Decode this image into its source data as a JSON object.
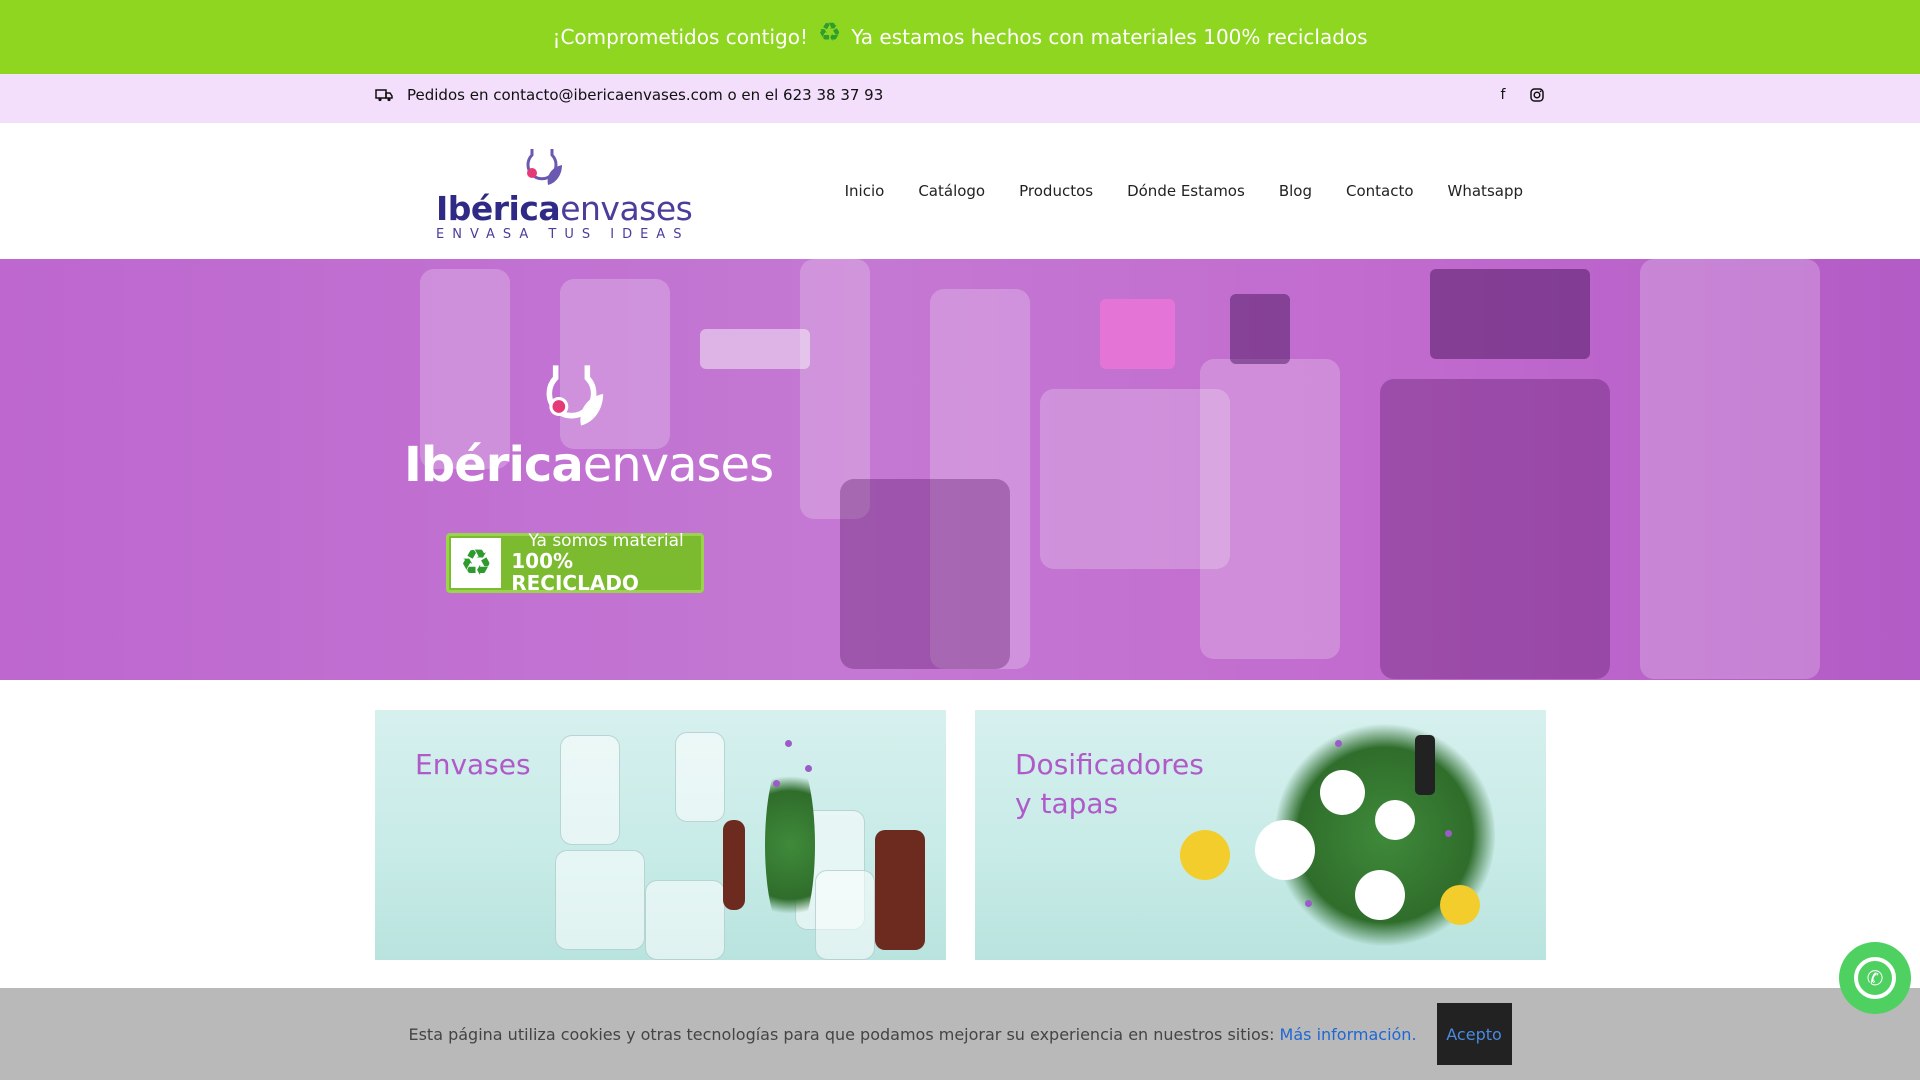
{
  "promo": {
    "text_before": "¡Comprometidos contigo!",
    "icon": "recycle-icon",
    "text_after": "Ya estamos hechos con materiales 100% reciclados",
    "bg_color": "#8fd620"
  },
  "topbar": {
    "contact_text": "Pedidos en contacto@ibericaenvases.com o en el 623 38 37 93",
    "social": [
      "facebook-icon",
      "instagram-icon"
    ],
    "bg_color": "#f3defb"
  },
  "logo": {
    "brand_bold": "Ibérica",
    "brand_light": "envases",
    "tagline": "ENVASA TUS IDEAS"
  },
  "nav": {
    "items": [
      "Inicio",
      "Catálogo",
      "Productos",
      "Dónde Estamos",
      "Blog",
      "Contacto",
      "Whatsapp"
    ]
  },
  "hero": {
    "brand_bold": "Ibérica",
    "brand_light": "envases",
    "badge_line1": "Ya somos material",
    "badge_line2": "100% RECICLADO",
    "overlay_color": "#c06bd0"
  },
  "cards": [
    {
      "title": "Envases"
    },
    {
      "title_line1": "Dosificadores",
      "title_line2": "y tapas"
    }
  ],
  "cookie": {
    "text": "Esta página utiliza cookies y otras tecnologías para que podamos mejorar su experiencia en nuestros sitios:",
    "link": "Más información.",
    "accept": "Acepto"
  },
  "accent_color": "#b05ac9"
}
